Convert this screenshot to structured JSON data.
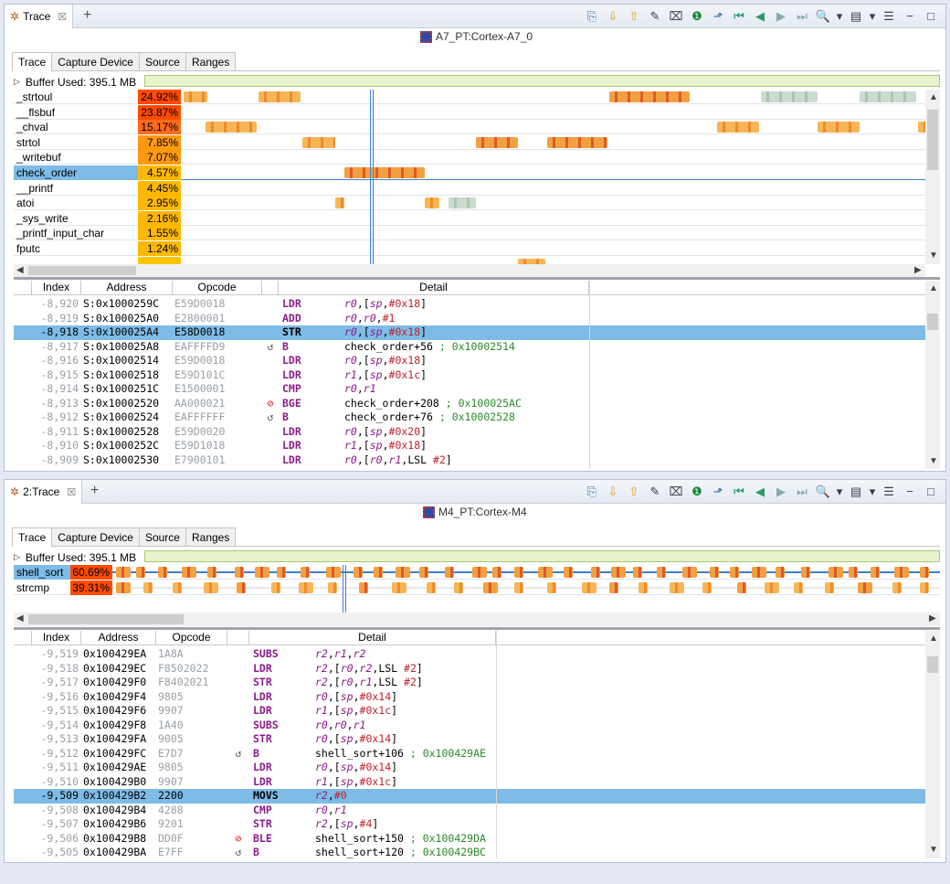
{
  "colors": {
    "accent": "#7ebbe7",
    "cursor": "#3b7fd2",
    "mnemonic": "#8b1c8b",
    "comment": "#2a8a2a",
    "pct_hot": "#ff4a00",
    "pct_warm": "#ffb000"
  },
  "view1": {
    "tab_label": "Trace",
    "subtitle": "A7_PT:Cortex-A7_0",
    "tabs": [
      "Trace",
      "Capture Device",
      "Source",
      "Ranges"
    ],
    "buffer": "Buffer Used: 395.1 MB",
    "functions": [
      {
        "name": "_strtoul",
        "pct": "24.92%",
        "value": 24.92
      },
      {
        "name": "__flsbuf",
        "pct": "23.87%",
        "value": 23.87
      },
      {
        "name": "_chval",
        "pct": "15.17%",
        "value": 15.17
      },
      {
        "name": "strtol",
        "pct": "7.85%",
        "value": 7.85
      },
      {
        "name": "_writebuf",
        "pct": "7.07%",
        "value": 7.07
      },
      {
        "name": "check_order",
        "pct": "4.57%",
        "value": 4.57
      },
      {
        "name": "__printf",
        "pct": "4.45%",
        "value": 4.45
      },
      {
        "name": "atoi",
        "pct": "2.95%",
        "value": 2.95
      },
      {
        "name": "_sys_write",
        "pct": "2.16%",
        "value": 2.16
      },
      {
        "name": "_printf_input_char",
        "pct": "1.55%",
        "value": 1.55
      },
      {
        "name": "fputc",
        "pct": "1.24%",
        "value": 1.24
      }
    ],
    "selected_function": "check_order",
    "columns": [
      "Index",
      "Address",
      "Opcode",
      "",
      "Detail"
    ],
    "rows": [
      {
        "idx": "-8,920",
        "addr": "S:0x1000259C",
        "op": "E59D0018",
        "icon": "",
        "mn": "LDR",
        "args": "r0,[sp,#0x18]",
        "cmt": ""
      },
      {
        "idx": "-8,919",
        "addr": "S:0x100025A0",
        "op": "E2800001",
        "icon": "",
        "mn": "ADD",
        "args": "r0,r0,#1",
        "cmt": ""
      },
      {
        "idx": "-8,918",
        "addr": "S:0x100025A4",
        "op": "E58D0018",
        "icon": "",
        "mn": "STR",
        "args": "r0,[sp,#0x18]",
        "cmt": "",
        "sel": true
      },
      {
        "idx": "-8,917",
        "addr": "S:0x100025A8",
        "op": "EAFFFFD9",
        "icon": "branch",
        "mn": "B",
        "args": "check_order+56",
        "cmt": "; 0x10002514"
      },
      {
        "idx": "-8,916",
        "addr": "S:0x10002514",
        "op": "E59D0018",
        "icon": "",
        "mn": "LDR",
        "args": "r0,[sp,#0x18]",
        "cmt": ""
      },
      {
        "idx": "-8,915",
        "addr": "S:0x10002518",
        "op": "E59D101C",
        "icon": "",
        "mn": "LDR",
        "args": "r1,[sp,#0x1c]",
        "cmt": ""
      },
      {
        "idx": "-8,914",
        "addr": "S:0x1000251C",
        "op": "E1500001",
        "icon": "",
        "mn": "CMP",
        "args": "r0,r1",
        "cmt": ""
      },
      {
        "idx": "-8,913",
        "addr": "S:0x10002520",
        "op": "AA000021",
        "icon": "stop",
        "mn": "BGE",
        "args": "check_order+208",
        "cmt": "; 0x100025AC"
      },
      {
        "idx": "-8,912",
        "addr": "S:0x10002524",
        "op": "EAFFFFFF",
        "icon": "branch",
        "mn": "B",
        "args": "check_order+76",
        "cmt": "; 0x10002528"
      },
      {
        "idx": "-8,911",
        "addr": "S:0x10002528",
        "op": "E59D0020",
        "icon": "",
        "mn": "LDR",
        "args": "r0,[sp,#0x20]",
        "cmt": ""
      },
      {
        "idx": "-8,910",
        "addr": "S:0x1000252C",
        "op": "E59D1018",
        "icon": "",
        "mn": "LDR",
        "args": "r1,[sp,#0x18]",
        "cmt": ""
      },
      {
        "idx": "-8,909",
        "addr": "S:0x10002530",
        "op": "E7900101",
        "icon": "",
        "mn": "LDR",
        "args": "r0,[r0,r1,LSL #2]",
        "cmt": ""
      }
    ]
  },
  "view2": {
    "tab_label": "2:Trace",
    "subtitle": "M4_PT:Cortex-M4",
    "tabs": [
      "Trace",
      "Capture Device",
      "Source",
      "Ranges"
    ],
    "buffer": "Buffer Used: 395.1 MB",
    "functions": [
      {
        "name": "shell_sort",
        "pct": "60.69%",
        "value": 60.69
      },
      {
        "name": "strcmp",
        "pct": "39.31%",
        "value": 39.31
      }
    ],
    "selected_function": "shell_sort",
    "columns": [
      "Index",
      "Address",
      "Opcode",
      "",
      "Detail"
    ],
    "rows": [
      {
        "idx": "-9,519",
        "addr": "0x100429EA",
        "op": "1A8A",
        "icon": "",
        "mn": "SUBS",
        "args": "r2,r1,r2",
        "cmt": ""
      },
      {
        "idx": "-9,518",
        "addr": "0x100429EC",
        "op": "F8502022",
        "icon": "",
        "mn": "LDR",
        "args": "r2,[r0,r2,LSL #2]",
        "cmt": ""
      },
      {
        "idx": "-9,517",
        "addr": "0x100429F0",
        "op": "F8402021",
        "icon": "",
        "mn": "STR",
        "args": "r2,[r0,r1,LSL #2]",
        "cmt": ""
      },
      {
        "idx": "-9,516",
        "addr": "0x100429F4",
        "op": "9805",
        "icon": "",
        "mn": "LDR",
        "args": "r0,[sp,#0x14]",
        "cmt": ""
      },
      {
        "idx": "-9,515",
        "addr": "0x100429F6",
        "op": "9907",
        "icon": "",
        "mn": "LDR",
        "args": "r1,[sp,#0x1c]",
        "cmt": ""
      },
      {
        "idx": "-9,514",
        "addr": "0x100429F8",
        "op": "1A40",
        "icon": "",
        "mn": "SUBS",
        "args": "r0,r0,r1",
        "cmt": ""
      },
      {
        "idx": "-9,513",
        "addr": "0x100429FA",
        "op": "9005",
        "icon": "",
        "mn": "STR",
        "args": "r0,[sp,#0x14]",
        "cmt": ""
      },
      {
        "idx": "-9,512",
        "addr": "0x100429FC",
        "op": "E7D7",
        "icon": "branch",
        "mn": "B",
        "args": "shell_sort+106",
        "cmt": "; 0x100429AE"
      },
      {
        "idx": "-9,511",
        "addr": "0x100429AE",
        "op": "9805",
        "icon": "",
        "mn": "LDR",
        "args": "r0,[sp,#0x14]",
        "cmt": ""
      },
      {
        "idx": "-9,510",
        "addr": "0x100429B0",
        "op": "9907",
        "icon": "",
        "mn": "LDR",
        "args": "r1,[sp,#0x1c]",
        "cmt": ""
      },
      {
        "idx": "-9,509",
        "addr": "0x100429B2",
        "op": "2200",
        "icon": "",
        "mn": "MOVS",
        "args": "r2,#0",
        "cmt": "",
        "sel": true
      },
      {
        "idx": "-9,508",
        "addr": "0x100429B4",
        "op": "4288",
        "icon": "",
        "mn": "CMP",
        "args": "r0,r1",
        "cmt": ""
      },
      {
        "idx": "-9,507",
        "addr": "0x100429B6",
        "op": "9201",
        "icon": "",
        "mn": "STR",
        "args": "r2,[sp,#4]",
        "cmt": ""
      },
      {
        "idx": "-9,506",
        "addr": "0x100429B8",
        "op": "DD0F",
        "icon": "stop",
        "mn": "BLE",
        "args": "shell_sort+150",
        "cmt": "; 0x100429DA"
      },
      {
        "idx": "-9,505",
        "addr": "0x100429BA",
        "op": "E7FF",
        "icon": "branch",
        "mn": "B",
        "args": "shell_sort+120",
        "cmt": "; 0x100429BC"
      }
    ]
  },
  "toolbar_icons": [
    "export-icon",
    "step-down-icon",
    "step-up-icon",
    "pen-icon",
    "clear-icon",
    "info-icon",
    "chart-icon",
    "first-icon",
    "prev-icon",
    "next-icon",
    "last-icon",
    "zoom-icon",
    "dropdown-icon",
    "layout-icon",
    "dropdown-icon",
    "menu-icon",
    "minimize-icon",
    "maximize-icon"
  ]
}
